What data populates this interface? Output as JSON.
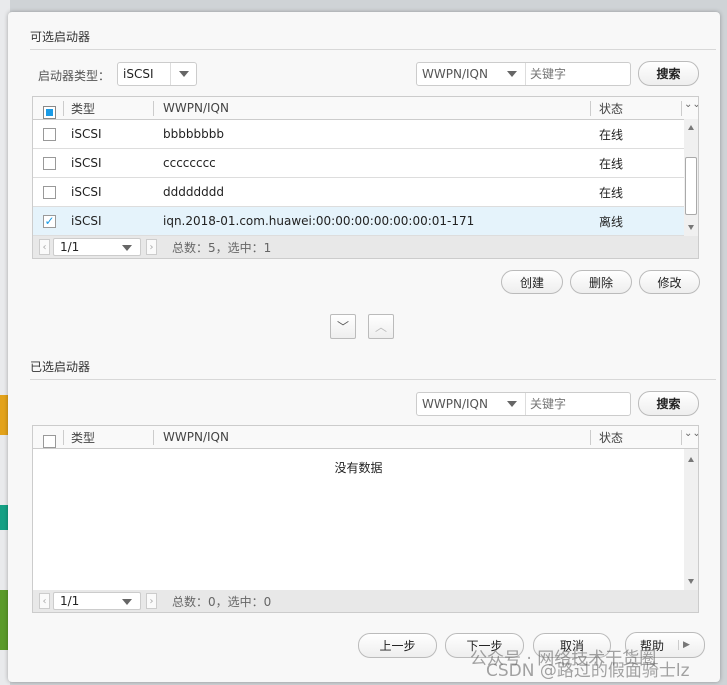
{
  "available": {
    "title": "可选启动器",
    "type_label": "启动器类型：",
    "type_value": "iSCSI",
    "search_field": "WWPN/IQN",
    "search_placeholder": "关键字",
    "search_button": "搜索",
    "columns": [
      "类型",
      "WWPN/IQN",
      "状态"
    ],
    "rows": [
      {
        "type": "iSCSI",
        "id": "bbbbbbbb",
        "status": "在线",
        "checked": false
      },
      {
        "type": "iSCSI",
        "id": "cccccccc",
        "status": "在线",
        "checked": false
      },
      {
        "type": "iSCSI",
        "id": "dddddddd",
        "status": "在线",
        "checked": false
      },
      {
        "type": "iSCSI",
        "id": "iqn.2018-01.com.huawei:00:00:00:00:00:00:01-171",
        "status": "离线",
        "checked": true
      }
    ],
    "page": "1/1",
    "summary": "总数：5，选中：1",
    "create_button": "创建",
    "delete_button": "删除",
    "modify_button": "修改"
  },
  "selected": {
    "title": "已选启动器",
    "search_field": "WWPN/IQN",
    "search_placeholder": "关键字",
    "search_button": "搜索",
    "columns": [
      "类型",
      "WWPN/IQN",
      "状态"
    ],
    "empty_text": "没有数据",
    "page": "1/1",
    "summary": "总数：0，选中：0"
  },
  "footer": {
    "prev": "上一步",
    "next": "下一步",
    "cancel": "取消",
    "help": "帮助"
  },
  "watermark": {
    "line1": "公众号 · 网络技术干货圈",
    "line2": "CSDN @路过的假面骑士lz"
  },
  "colors": {
    "accent": "#1a9be6",
    "selected_row": "#e5f3fb"
  }
}
